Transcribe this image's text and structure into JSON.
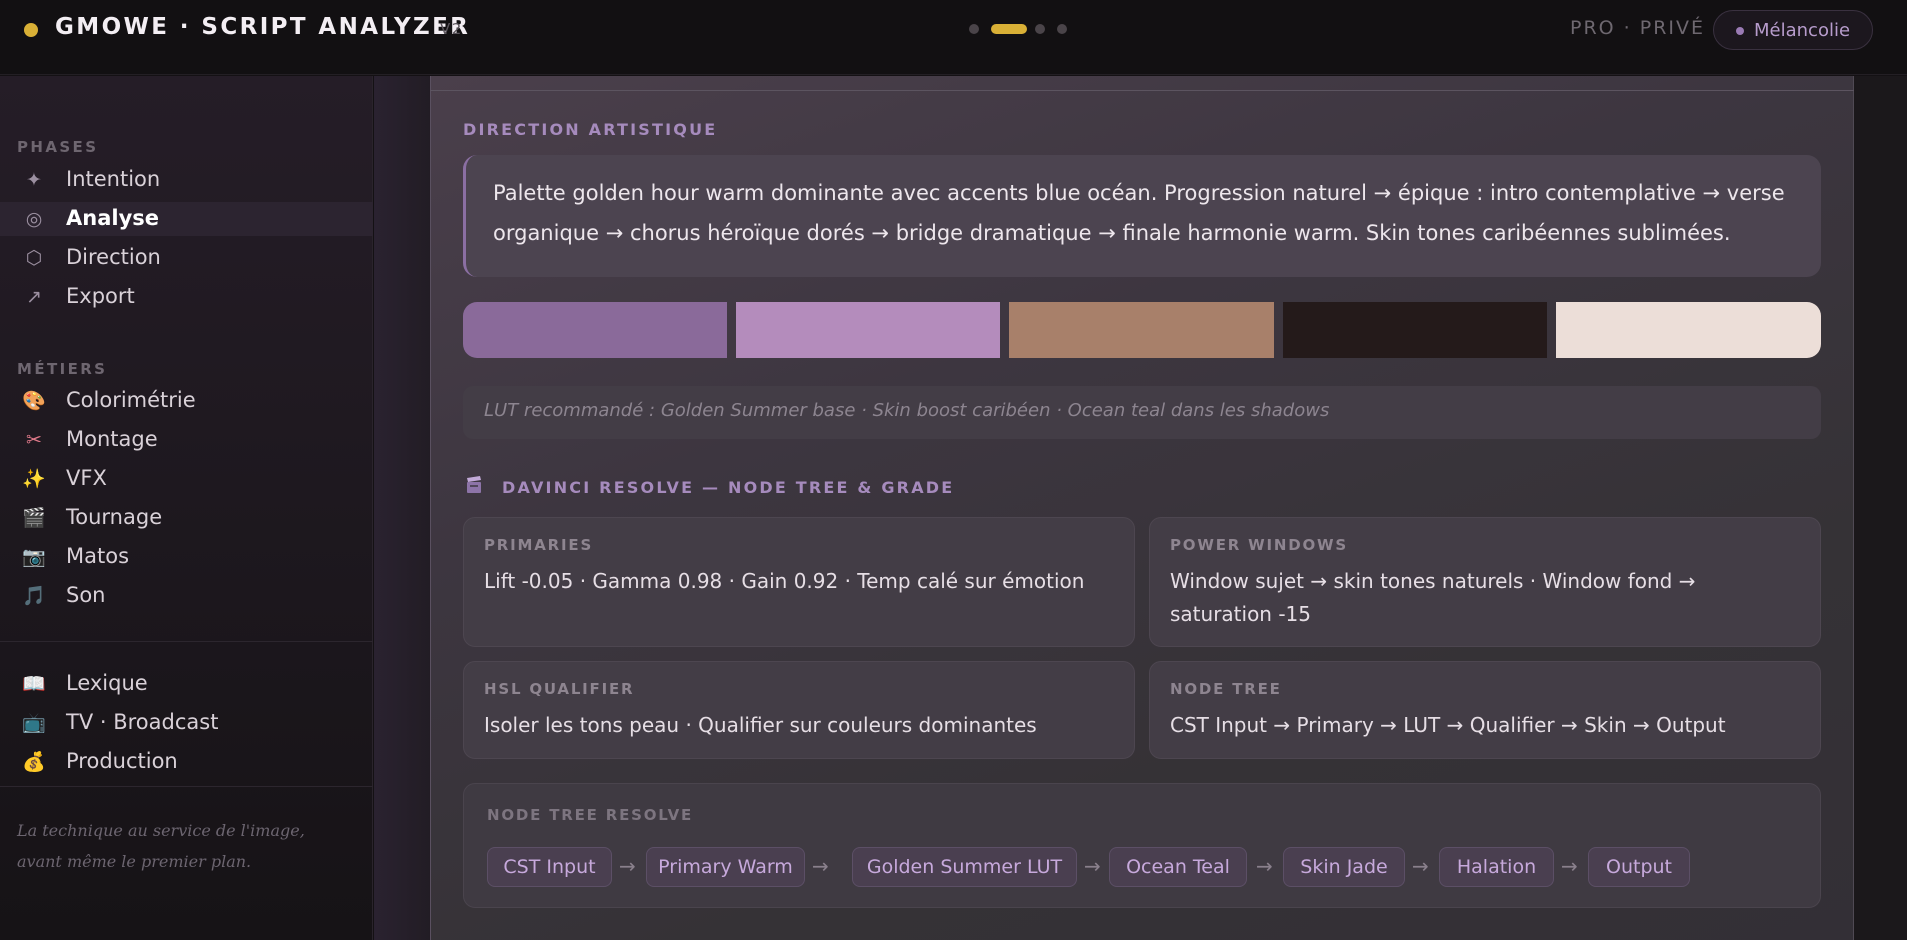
{
  "header": {
    "title": "GMOWE · SCRIPT ANALYZER",
    "version": "V2",
    "plan": "PRO · PRIVÉ",
    "mood": "Mélancolie",
    "brand_color": "#d9b036"
  },
  "sidebar": {
    "phases_label": "PHASES",
    "phases": [
      {
        "icon": "✦",
        "icon_name": "sparkle-icon",
        "label": "Intention"
      },
      {
        "icon": "◎",
        "icon_name": "target-icon",
        "label": "Analyse",
        "active": true
      },
      {
        "icon": "⬡",
        "icon_name": "hexagon-icon",
        "label": "Direction"
      },
      {
        "icon": "↗",
        "icon_name": "export-arrow-icon",
        "label": "Export"
      }
    ],
    "metiers_label": "MÉTIERS",
    "metiers": [
      {
        "icon": "🎨",
        "icon_name": "palette-icon",
        "label": "Colorimétrie"
      },
      {
        "icon": "✂",
        "icon_name": "scissors-icon",
        "label": "Montage"
      },
      {
        "icon": "✨",
        "icon_name": "sparkles-icon",
        "label": "VFX"
      },
      {
        "icon": "🎬",
        "icon_name": "clapper-icon",
        "label": "Tournage"
      },
      {
        "icon": "📷",
        "icon_name": "camera-icon",
        "label": "Matos"
      },
      {
        "icon": "🎵",
        "icon_name": "music-note-icon",
        "label": "Son"
      }
    ],
    "extras": [
      {
        "icon": "📖",
        "icon_name": "book-icon",
        "label": "Lexique"
      },
      {
        "icon": "📺",
        "icon_name": "tv-icon",
        "label": "TV · Broadcast"
      },
      {
        "icon": "💰",
        "icon_name": "money-bag-icon",
        "label": "Production"
      }
    ],
    "tagline": "La technique au service de l'image, avant même le premier plan."
  },
  "direction": {
    "label": "DIRECTION ARTISTIQUE",
    "text": "Palette golden hour warm dominante avec accents blue océan. Progression naturel → épique : intro contemplative → verse organique → chorus héroïque dorés → bridge dramatique → finale harmonie warm. Skin tones caribéennes sublimées.",
    "palette": [
      "#8a6a9a",
      "#b48cbc",
      "#a8806a",
      "#241a1a",
      "#ecded8"
    ],
    "lut": "LUT recommandé : Golden Summer base · Skin boost caribéen · Ocean teal dans les shadows"
  },
  "resolve": {
    "label": "DAVINCI RESOLVE — NODE TREE & GRADE",
    "tiles": [
      {
        "label": "PRIMARIES",
        "text": "Lift -0.05 · Gamma 0.98 · Gain 0.92 · Temp calé sur émotion"
      },
      {
        "label": "POWER WINDOWS",
        "text": "Window sujet → skin tones naturels · Window fond → saturation -15"
      },
      {
        "label": "HSL QUALIFIER",
        "text": "Isoler les tons peau · Qualifier sur couleurs dominantes"
      },
      {
        "label": "NODE TREE",
        "text": "CST Input → Primary → LUT → Qualifier → Skin → Output"
      }
    ],
    "tree_label": "NODE TREE RESOLVE",
    "nodes": [
      "CST Input",
      "Primary Warm",
      "Golden Summer LUT",
      "Ocean Teal",
      "Skin Jade",
      "Halation",
      "Output"
    ],
    "arrow": "→"
  }
}
